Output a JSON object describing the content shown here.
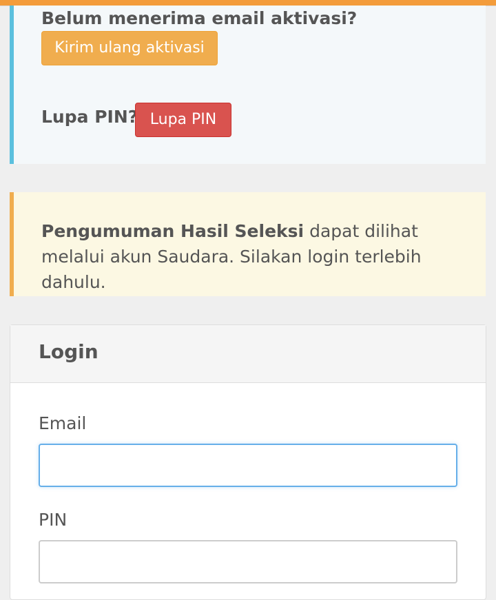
{
  "activation": {
    "question": "Belum menerima email aktivasi?",
    "resend_button": "Kirim ulang aktivasi",
    "forgot_label": "Lupa PIN?",
    "forgot_button": "Lupa PIN"
  },
  "announcement": {
    "bold_text": "Pengumuman Hasil Seleksi",
    "body_text": " dapat dilihat melalui akun Saudara. Silakan login terlebih dahulu."
  },
  "login": {
    "title": "Login",
    "email_label": "Email",
    "email_value": "",
    "pin_label": "PIN",
    "pin_value": ""
  },
  "colors": {
    "info_border": "#5bc0de",
    "warning_border": "#f0ad4e",
    "resend_button": "#f0ad4e",
    "forgot_button": "#d9534f",
    "focus_border": "#66afe9"
  }
}
